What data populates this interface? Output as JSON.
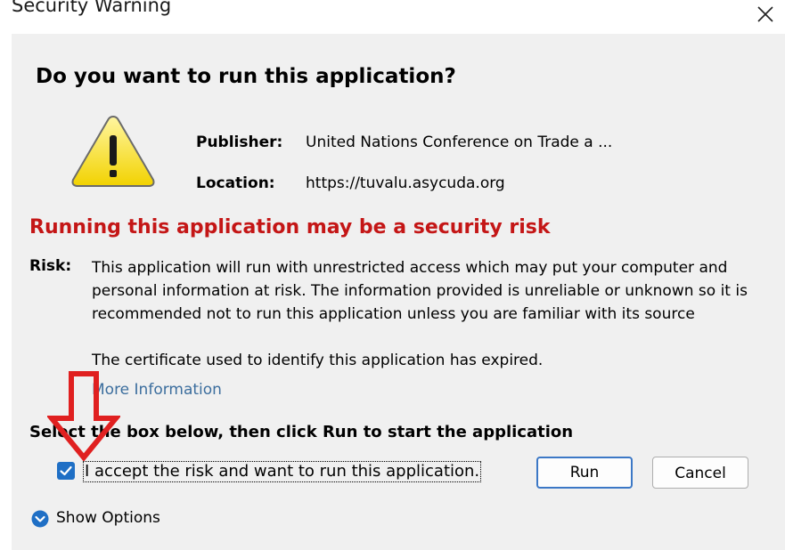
{
  "window": {
    "title": "Security Warning"
  },
  "dialog": {
    "heading": "Do you want to run this application?",
    "publisher_label": "Publisher:",
    "publisher_value": "United Nations Conference on Trade a ...",
    "location_label": "Location:",
    "location_value": "https://tuvalu.asycuda.org",
    "risk_heading": "Running this application may be a security risk",
    "risk_label": "Risk:",
    "risk_text": "This application will run with unrestricted access which may put your computer and personal information at risk. The information provided is unreliable or unknown so it is recommended not to run this application unless you are familiar with its source",
    "certificate_text": "The certificate used to identify this application has expired.",
    "more_information": "More Information",
    "select_instruction": "Select the box below, then click Run to start the application",
    "accept_label": "I accept the risk and want to run this application.",
    "accept_checked": true,
    "run_label": "Run",
    "cancel_label": "Cancel",
    "show_options": "Show Options"
  },
  "colors": {
    "risk_heading": "#c41616",
    "link": "#3c6e9e",
    "checkbox": "#1f6fc5",
    "annotation_arrow": "#e02020"
  },
  "icons": {
    "warning": "warning-triangle-icon",
    "close": "close-icon",
    "checkmark": "checkmark-icon",
    "options": "chevron-down-circle-icon",
    "annotation": "red-arrow-down-icon"
  }
}
